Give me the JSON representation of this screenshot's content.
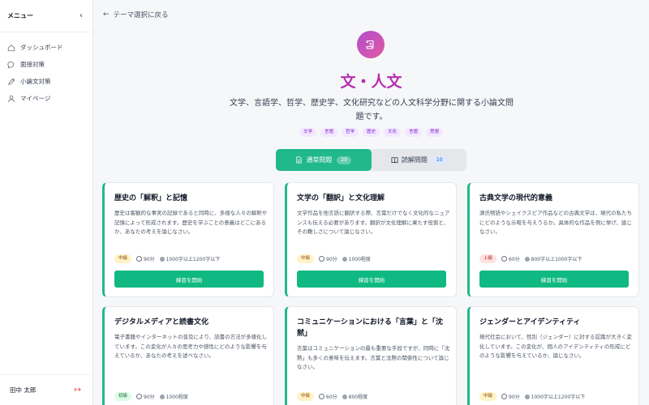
{
  "sidebar": {
    "title": "メニュー",
    "items": [
      {
        "label": "ダッシュボード",
        "icon": "home-icon"
      },
      {
        "label": "面接対策",
        "icon": "chat-icon"
      },
      {
        "label": "小論文対策",
        "icon": "pen-icon"
      },
      {
        "label": "マイページ",
        "icon": "user-icon"
      }
    ],
    "user": "田中 太郎"
  },
  "main": {
    "back_label": "テーマ選択に戻る",
    "title": "文・人文",
    "description": "文学、言語学、哲学、歴史学、文化研究などの人文科学分野に関する小論文問題です。",
    "tags": [
      "文学",
      "言語",
      "哲学",
      "歴史",
      "文化",
      "言語",
      "思想"
    ],
    "tabs": [
      {
        "label": "通常問題",
        "count": "20"
      },
      {
        "label": "読解問題",
        "count": "10"
      }
    ],
    "start_label": "練習を開始",
    "cards": [
      {
        "title": "歴史の「解釈」と記憶",
        "description": "歴史は客観的な事実の記録であると同時に、多様な人々の解釈や記憶によって形成されます。歴史を学ぶことの意義はどこにあるか、あなたの考えを論じなさい。",
        "level": "中級",
        "time": "90分",
        "length": "1000字以上1200字以下"
      },
      {
        "title": "文学の「翻訳」と文化理解",
        "description": "文学作品を他言語に翻訳する際、言葉だけでなく文化的なニュアンスも伝える必要があります。翻訳が文化理解に果たす役割と、その難しさについて論じなさい。",
        "level": "中級",
        "time": "90分",
        "length": "1000程度"
      },
      {
        "title": "古典文学の現代的意義",
        "description": "源氏物語やシェイクスピア作品などの古典文学は、現代の私たちにどのような示唆を与えうるか。具体的な作品を例に挙げ、論じなさい。",
        "level": "上級",
        "time": "60分",
        "length": "800字以上1000字以下"
      },
      {
        "title": "デジタルメディアと読書文化",
        "description": "電子書籍やインターネットの普及により、読書の方法が多様化しています。この変化が人々の思考力や感性にどのような影響を与えているか、あなたの考えを述べなさい。",
        "level": "初級",
        "time": "90分",
        "length": "1000程度"
      },
      {
        "title": "コミュニケーションにおける「言葉」と「沈黙」",
        "description": "言葉はコミュニケーションの最も重要な手段ですが、同時に「沈黙」も多くの意味を伝えます。言葉と沈黙の関係性について論じなさい。",
        "level": "中級",
        "time": "60分",
        "length": "800程度"
      },
      {
        "title": "ジェンダーとアイデンティティ",
        "description": "現代社会において、性別（ジェンダー）に対する認識が大きく変化しています。この変化が、個人のアイデンティティの形成にどのような影響を与えているか、論じなさい。",
        "level": "中級",
        "time": "90分",
        "length": "1000字以上1200字以下"
      }
    ]
  },
  "colors": {
    "accent": "#10b981",
    "title": "#b62fb0",
    "tag_bg": "#f3e8ff"
  }
}
